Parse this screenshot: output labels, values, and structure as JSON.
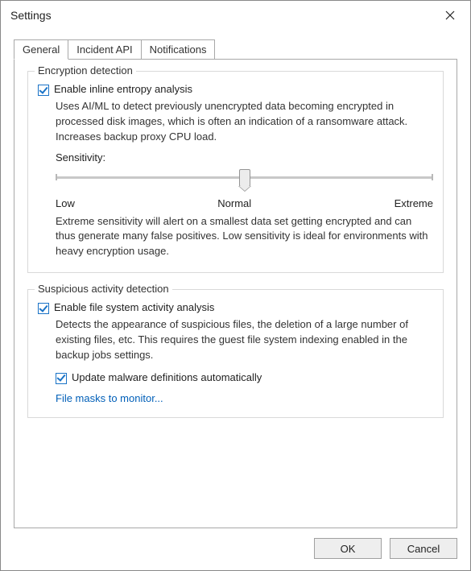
{
  "window": {
    "title": "Settings"
  },
  "tabs": {
    "general": "General",
    "incident_api": "Incident API",
    "notifications": "Notifications",
    "active": "general"
  },
  "encryption": {
    "legend": "Encryption detection",
    "enable_label": "Enable inline entropy analysis",
    "enable_checked": true,
    "description": "Uses AI/ML to detect previously unencrypted data becoming encrypted in processed disk images, which is often an indication of a ransomware attack. Increases backup proxy CPU load.",
    "sensitivity_label": "Sensitivity:",
    "slider": {
      "min_label": "Low",
      "mid_label": "Normal",
      "max_label": "Extreme",
      "value_percent": 50
    },
    "sensitivity_note": "Extreme sensitivity will alert on a smallest data set getting encrypted and can thus generate many false positives. Low sensitivity is ideal for environments with heavy encryption usage."
  },
  "suspicious": {
    "legend": "Suspicious activity detection",
    "enable_label": "Enable file system activity analysis",
    "enable_checked": true,
    "description": "Detects the appearance of suspicious files, the deletion of a large number of existing files, etc. This requires the guest file system indexing enabled in the backup jobs settings.",
    "auto_update_label": "Update malware definitions automatically",
    "auto_update_checked": true,
    "file_masks_link": "File masks to monitor..."
  },
  "buttons": {
    "ok": "OK",
    "cancel": "Cancel"
  }
}
